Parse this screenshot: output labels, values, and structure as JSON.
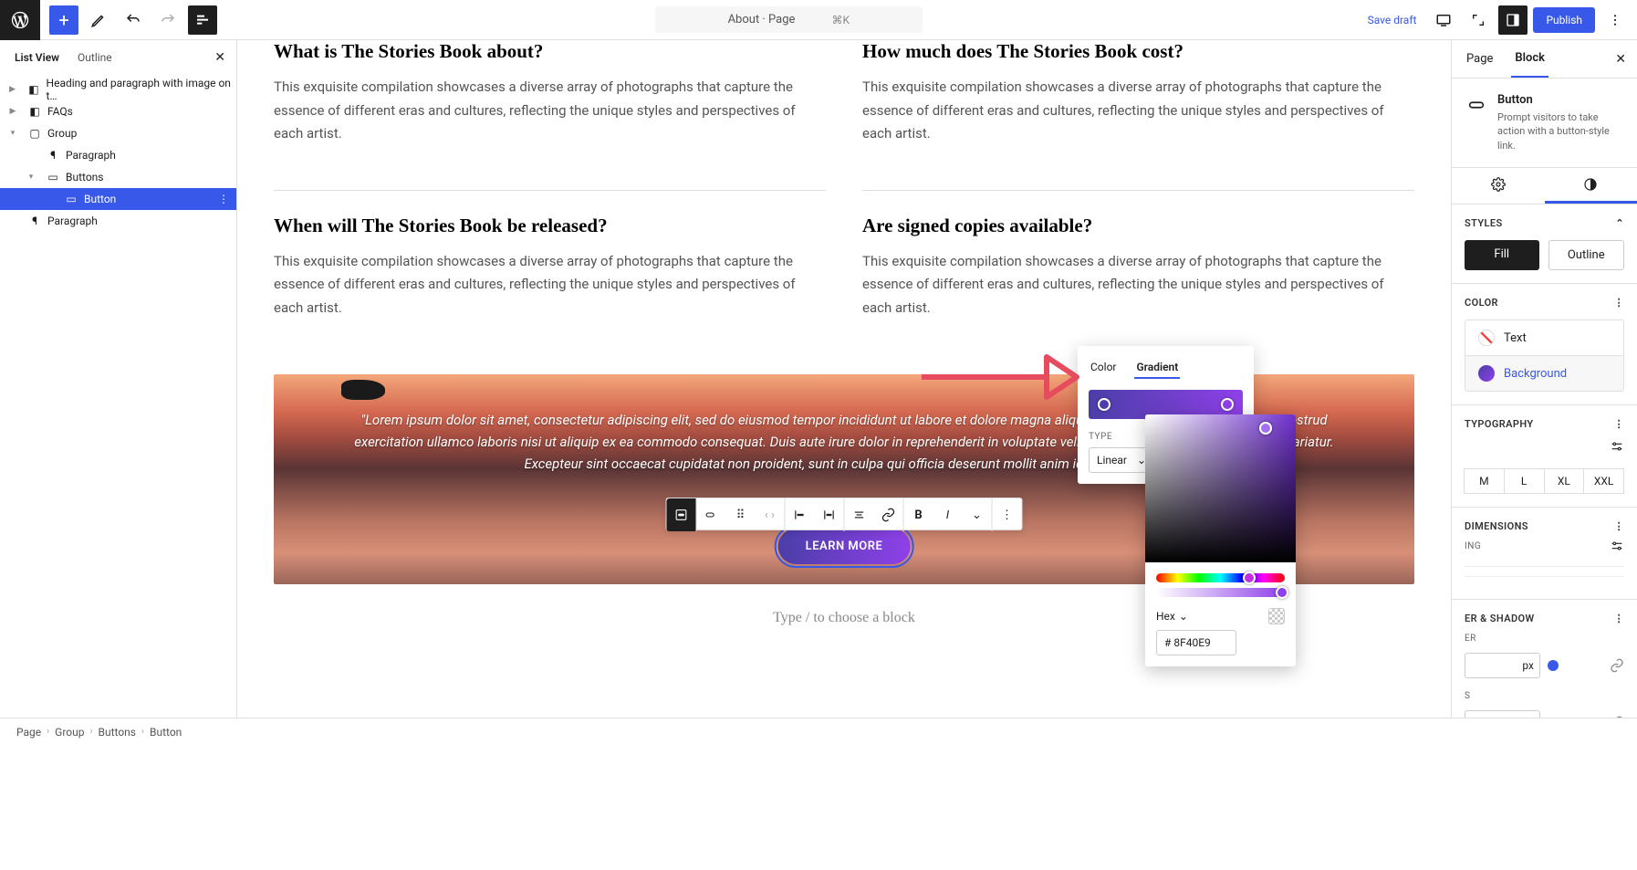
{
  "topbar": {
    "page_title": "About · Page",
    "shortcut": "⌘K",
    "save_draft": "Save draft",
    "publish": "Publish"
  },
  "list_view": {
    "tabs": {
      "list": "List View",
      "outline": "Outline"
    },
    "items": [
      {
        "label": "Heading and paragraph with image on t…"
      },
      {
        "label": "FAQs"
      },
      {
        "label": "Group"
      },
      {
        "label": "Paragraph"
      },
      {
        "label": "Buttons"
      },
      {
        "label": "Button"
      },
      {
        "label": "Paragraph"
      }
    ]
  },
  "content": {
    "h1": "What is The Stories Book about?",
    "p1": "This exquisite compilation showcases a diverse array of photographs that capture the essence of different eras and cultures, reflecting the unique styles and perspectives of each artist.",
    "h2": "How much does The Stories Book cost?",
    "p2": "This exquisite compilation showcases a diverse array of photographs that capture the essence of different eras and cultures, reflecting the unique styles and perspectives of each artist.",
    "h3": "When will The Stories Book be released?",
    "p3": "This exquisite compilation showcases a diverse array of photographs that capture the essence of different eras and cultures, reflecting the unique styles and perspectives of each artist.",
    "h4": "Are signed copies available?",
    "p4": "This exquisite compilation showcases a diverse array of photographs that capture the essence of different eras and cultures, reflecting the unique styles and perspectives of each artist.",
    "quote": "\"Lorem ipsum dolor sit amet, consectetur adipiscing elit, sed do eiusmod tempor incididunt ut labore et dolore magna aliqua. Ut enim ad minim veniam, quis nostrud exercitation ullamco laboris nisi ut aliquip ex ea commodo consequat. Duis aute irure dolor in reprehenderit in voluptate velit esse cillum dolore eu fugiat nulla pariatur. Excepteur sint occaecat cupidatat non proident, sunt in culpa qui officia deserunt mollit anim id est laborum.\"",
    "learn": "LEARN MORE",
    "prompt": "Type / to choose a block"
  },
  "block_panel": {
    "tabs": {
      "page": "Page",
      "block": "Block"
    },
    "name": "Button",
    "desc": "Prompt visitors to take action with a button-style link.",
    "styles_hdr": "Styles",
    "fill": "Fill",
    "outline": "Outline",
    "color_hdr": "Color",
    "text": "Text",
    "background": "Background",
    "typography_hdr": "Typography",
    "sizes": [
      "M",
      "L",
      "XL",
      "XXL"
    ],
    "dimensions_hdr": "Dimensions",
    "spacing_hdr": "ING",
    "border_hdr": "er & Shadow",
    "border_sub": "ER",
    "unit": "px",
    "radius_sub": "S"
  },
  "gradient": {
    "tab_color": "Color",
    "tab_gradient": "Gradient",
    "type_label": "TYPE",
    "type_value": "Linear"
  },
  "picker": {
    "format": "Hex",
    "hex_prefix": "#",
    "hex_value": "8F40E9"
  },
  "breadcrumb": [
    "Page",
    "Group",
    "Buttons",
    "Button"
  ]
}
